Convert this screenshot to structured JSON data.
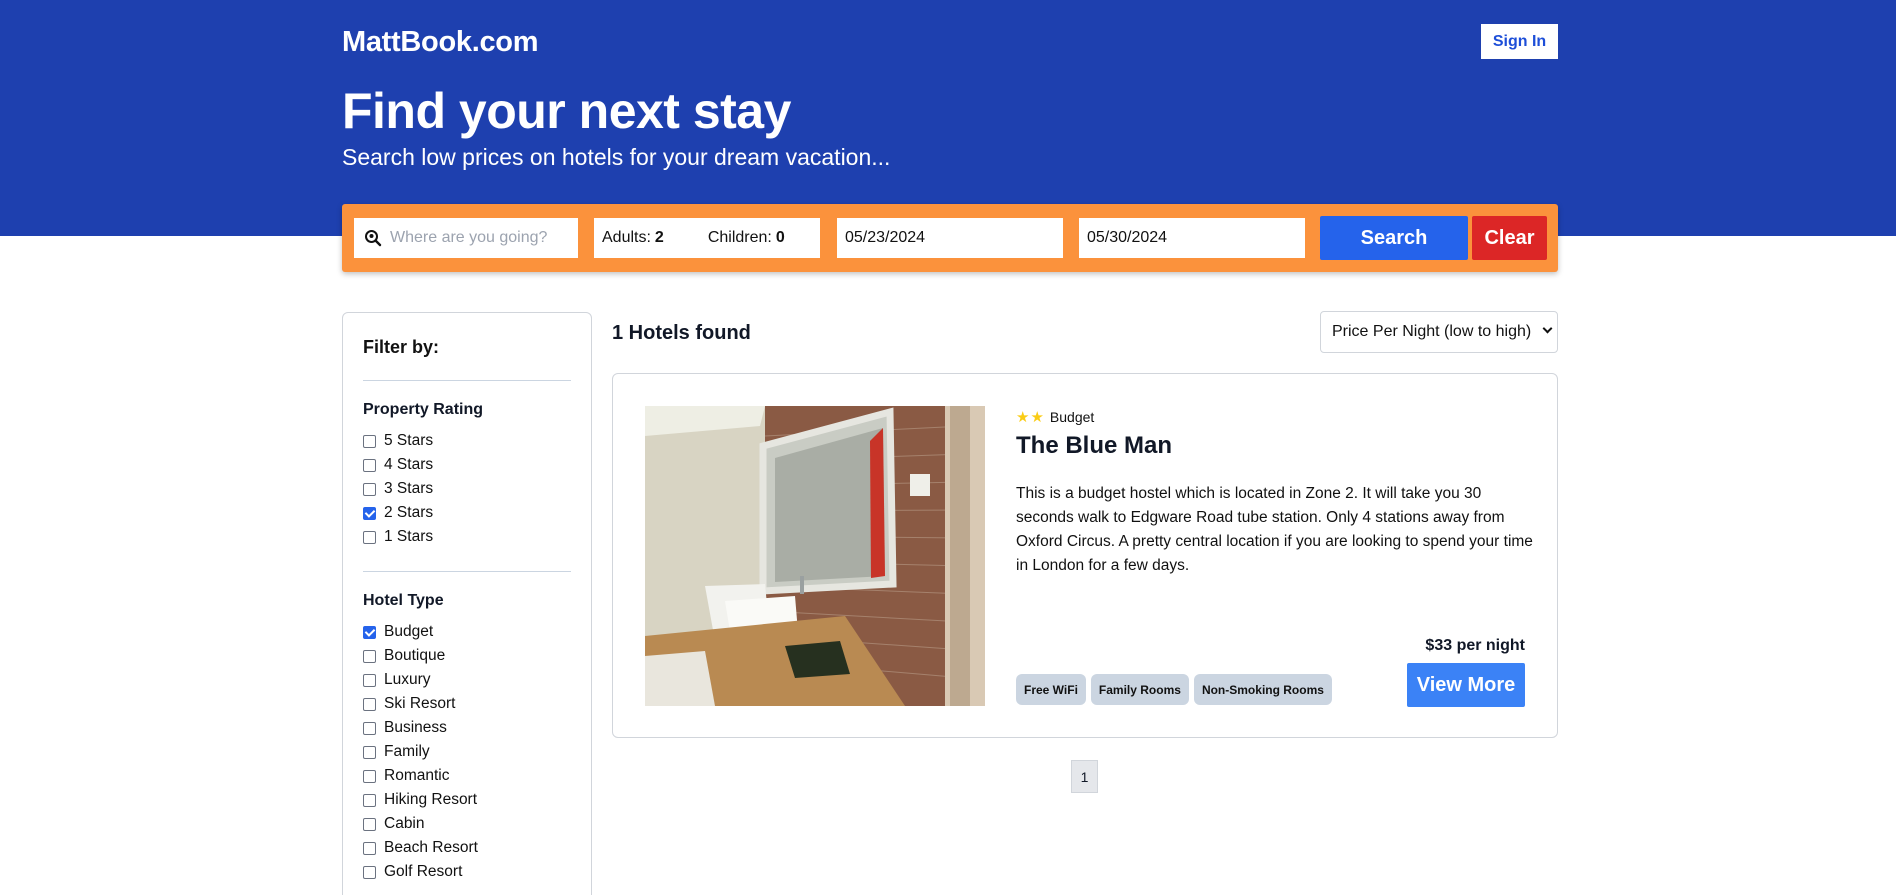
{
  "header": {
    "brand": "MattBook.com",
    "sign_in": "Sign In",
    "title": "Find your next stay",
    "subtitle": "Search low prices on hotels for your dream vacation...",
    "background_color": "#1e40af"
  },
  "search": {
    "destination_placeholder": "Where are you going?",
    "destination_icon": "search-location-icon",
    "adults_label": "Adults:",
    "adults_value": "2",
    "children_label": "Children:",
    "children_value": "0",
    "check_in": "05/23/2024",
    "check_out": "05/30/2024",
    "search_button": "Search",
    "clear_button": "Clear",
    "bar_color": "#fb923c"
  },
  "filters": {
    "title": "Filter by:",
    "rating": {
      "title": "Property Rating",
      "options": [
        {
          "label": "5 Stars",
          "checked": false
        },
        {
          "label": "4 Stars",
          "checked": false
        },
        {
          "label": "3 Stars",
          "checked": false
        },
        {
          "label": "2 Stars",
          "checked": true
        },
        {
          "label": "1 Stars",
          "checked": false
        }
      ]
    },
    "hotel_type": {
      "title": "Hotel Type",
      "options": [
        {
          "label": "Budget",
          "checked": true
        },
        {
          "label": "Boutique",
          "checked": false
        },
        {
          "label": "Luxury",
          "checked": false
        },
        {
          "label": "Ski Resort",
          "checked": false
        },
        {
          "label": "Business",
          "checked": false
        },
        {
          "label": "Family",
          "checked": false
        },
        {
          "label": "Romantic",
          "checked": false
        },
        {
          "label": "Hiking Resort",
          "checked": false
        },
        {
          "label": "Cabin",
          "checked": false
        },
        {
          "label": "Beach Resort",
          "checked": false
        },
        {
          "label": "Golf Resort",
          "checked": false
        }
      ]
    }
  },
  "results": {
    "count_text": "1 Hotels found",
    "sort_selected": "Price Per Night (low to high)",
    "hotels": [
      {
        "star_count": 2,
        "type": "Budget",
        "name": "The Blue Man",
        "description": "This is a budget hostel which is located in Zone 2. It will take you 30 seconds walk to Edgware Road tube station. Only 4 stations away from Oxford Circus. A pretty central location if you are looking to spend your time in London for a few days.",
        "facilities": [
          "Free WiFi",
          "Family Rooms",
          "Non-Smoking Rooms"
        ],
        "price": "$33 per night",
        "view_more": "View More"
      }
    ]
  },
  "pagination": {
    "pages": [
      "1"
    ]
  }
}
